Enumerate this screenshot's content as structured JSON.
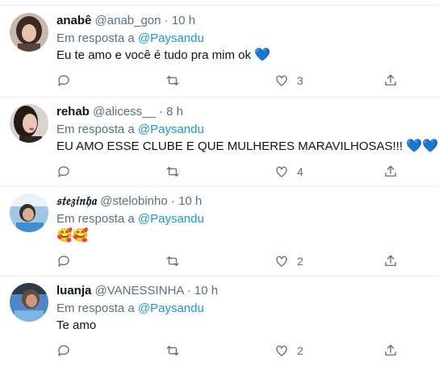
{
  "tweets": [
    {
      "name": "anabê",
      "handle": "@anab_gon",
      "dot": "·",
      "time": "10 h",
      "reply_prefix": "Em resposta a",
      "reply_to": "@Paysandu",
      "text": "Eu te amo e você é tudo pra mim ok",
      "emojis": "💙",
      "likes": "3"
    },
    {
      "name": "rehab",
      "handle": "@alicess__",
      "dot": "·",
      "time": "8 h",
      "reply_prefix": "Em resposta a",
      "reply_to": "@Paysandu",
      "text": "EU AMO ESSE CLUBE E QUE MULHERES MARAVILHOSAS!!!",
      "emojis": "💙💙💙",
      "likes": "4"
    },
    {
      "name": "𝔰𝔱𝔢𝔷𝔦𝔫𝔥𝔞",
      "handle": "@stelobinho",
      "dot": "·",
      "time": "10 h",
      "reply_prefix": "Em resposta a",
      "reply_to": "@Paysandu",
      "text": "",
      "emojis": "🥰🥰",
      "likes": "2"
    },
    {
      "name": "luanja",
      "handle": "@VANESSINHA",
      "dot": "·",
      "time": "10 h",
      "reply_prefix": "Em resposta a",
      "reply_to": "@Paysandu",
      "text": "Te amo",
      "emojis": "",
      "likes": "2"
    }
  ],
  "icons": [
    "reply-icon",
    "retweet-icon",
    "like-icon",
    "share-icon"
  ],
  "colors": {
    "text": "#0f1419",
    "muted": "#5b7083",
    "link": "#1b95e0",
    "divider": "#e6ecf0"
  }
}
